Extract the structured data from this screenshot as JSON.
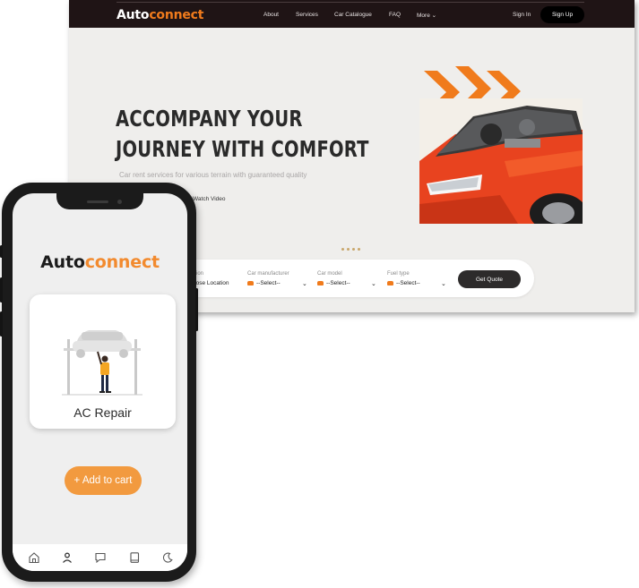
{
  "desktop": {
    "logo": {
      "brand_a": "Auto",
      "brand_b": "connect"
    },
    "nav": {
      "about": "About",
      "services": "Services",
      "catalogue": "Car Catalogue",
      "faq": "FAQ",
      "more": "More",
      "signin": "Sign In",
      "signup": "Sign Up"
    },
    "hero": {
      "title_line1": "ACCOMPANY YOUR",
      "title_line2": "JOURNEY WITH COMFORT",
      "subtitle": "Car rent services for various terrain with guaranteed quality",
      "watch": "Watch Video"
    },
    "quote": {
      "location_label": "ion",
      "location_value": "oose Location",
      "manufacturer_label": "Car manufacturer",
      "manufacturer_value": "--Select--",
      "model_label": "Car model",
      "model_value": "--Select--",
      "fuel_label": "Fuel type",
      "fuel_value": "--Select--",
      "button": "Get Quote"
    }
  },
  "mobile": {
    "logo": {
      "brand_a": "Auto",
      "brand_b": "connect"
    },
    "card_title": "AC Repair",
    "cart_button": "+ Add to cart",
    "tabs": [
      "home-icon",
      "person-icon",
      "chat-icon",
      "book-icon",
      "moon-icon"
    ]
  },
  "colors": {
    "accent": "#f07b1c",
    "nav_bg": "#1f1415",
    "cart_button": "#f29a3f"
  }
}
